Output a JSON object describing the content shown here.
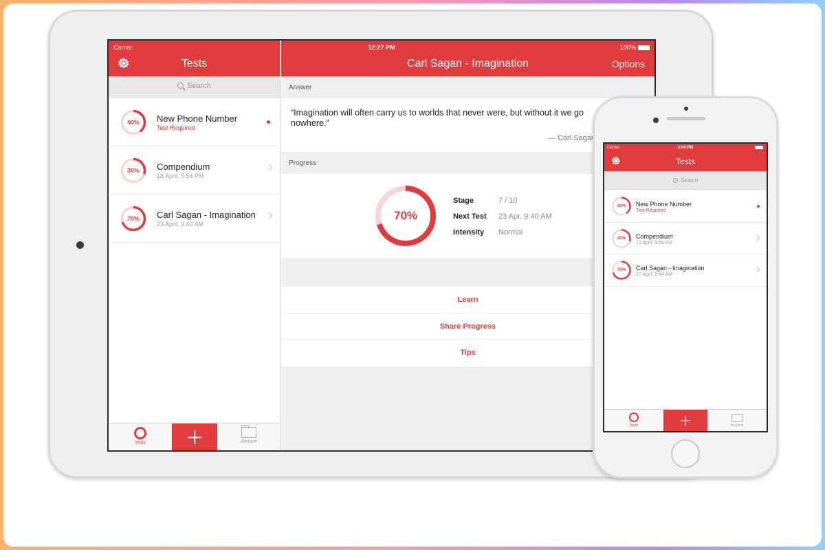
{
  "colors": {
    "accent": "#e03c3d",
    "ring_track": "#f6d5d5"
  },
  "ipad": {
    "status": {
      "carrier": "Carrier",
      "time": "12:27 PM",
      "battery": "100%"
    },
    "sidebar": {
      "title": "Tests",
      "search_placeholder": "Search",
      "items": [
        {
          "percent": "40%",
          "progress": 0.4,
          "title": "New Phone Number",
          "subtitle": "Test Required",
          "accessory": "dot"
        },
        {
          "percent": "30%",
          "progress": 0.3,
          "title": "Compendium",
          "subtitle": "18 April, 5:54 PM",
          "accessory": "chevron"
        },
        {
          "percent": "70%",
          "progress": 0.7,
          "title": "Carl Sagan - Imagination",
          "subtitle": "23 April, 9:40 AM",
          "accessory": "chevron"
        }
      ],
      "tabs": {
        "tests": "Tests",
        "archive": "Archive"
      }
    },
    "detail": {
      "title": "Carl Sagan - Imagination",
      "options": "Options",
      "answer_header": "Answer",
      "quote": "“Imagination will often carry us to worlds that never were, but without it we go nowhere.”",
      "author": "— Carl Sagan",
      "progress_header": "Progress",
      "percent": "70%",
      "progress": 0.7,
      "stats": [
        {
          "label": "Stage",
          "value": "7 / 10"
        },
        {
          "label": "Next Test",
          "value": "23 Apr, 9:40 AM"
        },
        {
          "label": "Intensity",
          "value": "Normal"
        }
      ],
      "actions": [
        "Learn",
        "Share Progress",
        "Tips"
      ]
    }
  },
  "iphone": {
    "status": {
      "carrier": "Carrier",
      "time": "6:04 PM"
    },
    "title": "Tests",
    "search_placeholder": "Search",
    "items": [
      {
        "percent": "40%",
        "progress": 0.4,
        "title": "New Phone Number",
        "subtitle": "Test Required",
        "accessory": "dot"
      },
      {
        "percent": "30%",
        "progress": 0.3,
        "title": "Compendium",
        "subtitle": "13 April, 9:58 AM",
        "accessory": "chevron"
      },
      {
        "percent": "70%",
        "progress": 0.7,
        "title": "Carl Sagan - Imagination",
        "subtitle": "17 April, 9:44 AM",
        "accessory": "chevron"
      }
    ],
    "tabs": {
      "tests": "Tests",
      "archive": "Archive"
    }
  }
}
